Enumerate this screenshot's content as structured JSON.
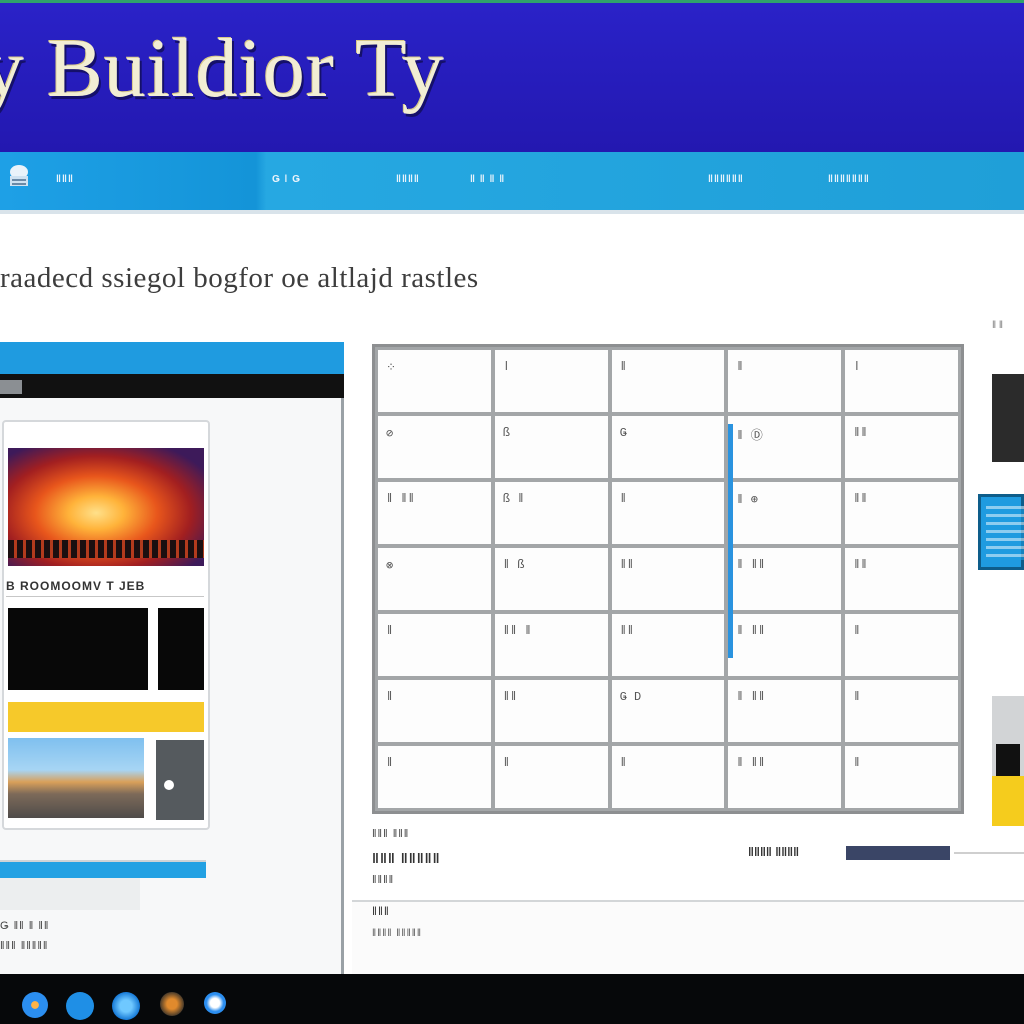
{
  "banner": {
    "title": "y Buildior Ty"
  },
  "navbar": {
    "items": [
      "ǁǁǁ",
      "Ǥ ǀ Ǥ",
      "ǁǁǁǁ",
      "ǁ ǁ ǁ ǁ",
      "ǁǁǁǁǁǁ",
      "ǁǁǁǁǁǁǁ"
    ]
  },
  "page": {
    "heading": "raadecd ssiegol bogfor oe altlajd rastles"
  },
  "left_panel": {
    "card_caption": "B ROOMOOMV T JEB",
    "footer_1": "Ǥ ǁǁ ǁ ǁǁ",
    "footer_2": "ǁǁǁ ǁǁǁǁǁ"
  },
  "grid": {
    "rows": [
      [
        "⁘",
        "ǀ",
        "ǁ",
        "ǁ",
        "ǀ"
      ],
      [
        "⊘",
        "ß",
        "Ǥ",
        "ǁ  Ⓓ",
        "ǁǁ"
      ],
      [
        "ǁ  ǁǁ",
        "ß  ǁ",
        "ǁ",
        "ǁ  ⊕",
        "ǁǁ"
      ],
      [
        "⊗",
        "ǁ  ß",
        "ǁǁ",
        "ǁ  ǁǁ",
        "ǁǁ"
      ],
      [
        "ǁ",
        "ǁǁ  ǁ",
        "ǁǁ",
        "ǁ  ǁǁ",
        "ǁ"
      ],
      [
        "ǁ",
        "ǁǁ",
        "Ǥ  D",
        "ǁ  ǁǁ",
        "ǁ"
      ],
      [
        "ǁ",
        "ǁ",
        "ǁ",
        "ǁ  ǁǁ",
        "ǁ"
      ]
    ],
    "under_1": "ǁǁǁ ǁǁǁ",
    "under_2": "ǁǁǁ ǁǁǁǁǁ",
    "under_3": "ǁǁǁǁ",
    "status_label": "ǁǁǁǁ ǁǁǁǁ",
    "lower_1": "ǁǁǁ",
    "lower_2": "ǁǁǁǁ ǁǁǁǁǁ"
  },
  "right_edge": {
    "tab_label": "ǁ ǁ"
  },
  "taskbar": {
    "icons": [
      "launcher-icon",
      "browser-icon",
      "app-icon",
      "files-icon",
      "settings-icon"
    ]
  },
  "colors": {
    "banner": "#2a22c8",
    "nav": "#1ea0e6",
    "accent_yellow": "#f6c92a",
    "taskbar": "#06080a"
  }
}
